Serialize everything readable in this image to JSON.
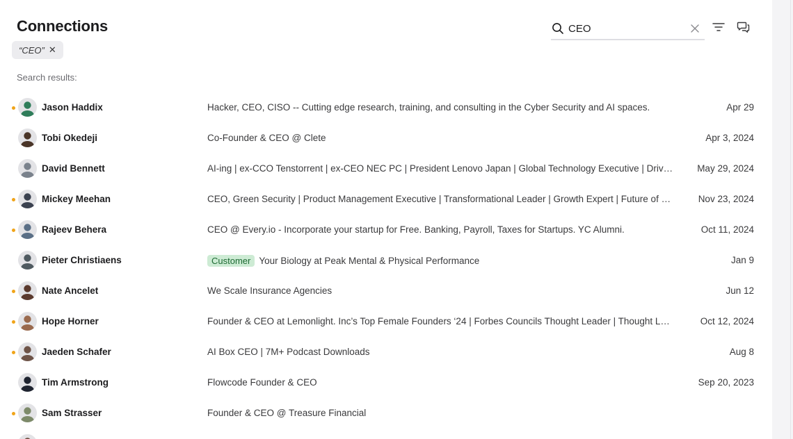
{
  "page": {
    "title": "Connections",
    "search_results_label": "Search results:"
  },
  "filter_chip": {
    "label": "“CEO”",
    "remove_glyph": "✕"
  },
  "search": {
    "value": "CEO"
  },
  "toolbar": {
    "filter_icon": "filter-icon",
    "message_icon": "message-icon"
  },
  "colors": {
    "unread_dot": "#f0a419",
    "badge_bg": "#cdebd4",
    "badge_text": "#1e6b34"
  },
  "connections": [
    {
      "name": "Jason Haddix",
      "headline": "Hacker, CEO, CISO -- Cutting edge research, training, and consulting in the Cyber Security and AI spaces.",
      "date": "Apr 29",
      "unread": true,
      "badge": "",
      "avatar_color": "#2f7d5a"
    },
    {
      "name": "Tobi Okedeji",
      "headline": "Co-Founder & CEO @ Clete",
      "date": "Apr 3, 2024",
      "unread": false,
      "badge": "",
      "avatar_color": "#4a3528"
    },
    {
      "name": "David Bennett",
      "headline": "AI-ing | ex-CCO Tenstorrent | ex-CEO NEC PC | President Lenovo Japan | Global Technology Executive | Driving growth and transformation",
      "date": "May 29, 2024",
      "unread": false,
      "badge": "",
      "avatar_color": "#7a828c"
    },
    {
      "name": "Mickey Meehan",
      "headline": "CEO, Green Security | Product Management Executive | Transformational Leader | Growth Expert | Future of Work",
      "date": "Nov 23, 2024",
      "unread": true,
      "badge": "",
      "avatar_color": "#3b4250"
    },
    {
      "name": "Rajeev Behera",
      "headline": "CEO @ Every.io - Incorporate your startup for Free. Banking, Payroll, Taxes for Startups. YC Alumni.",
      "date": "Oct 11, 2024",
      "unread": true,
      "badge": "",
      "avatar_color": "#5a6f86"
    },
    {
      "name": "Pieter Christiaens",
      "headline": "Your Biology at Peak Mental & Physical Performance",
      "date": "Jan 9",
      "unread": false,
      "badge": "Customer",
      "avatar_color": "#4f5a60"
    },
    {
      "name": "Nate Ancelet",
      "headline": "We Scale Insurance Agencies",
      "date": "Jun 12",
      "unread": true,
      "badge": "",
      "avatar_color": "#5b3a2e"
    },
    {
      "name": "Hope Horner",
      "headline": "Founder & CEO at Lemonlight. Inc’s Top Female Founders ‘24 | Forbes Councils Thought Leader | Thought Leadership",
      "date": "Oct 12, 2024",
      "unread": true,
      "badge": "",
      "avatar_color": "#9a6a4e"
    },
    {
      "name": "Jaeden Schafer",
      "headline": "AI Box CEO | 7M+ Podcast Downloads",
      "date": "Aug 8",
      "unread": true,
      "badge": "",
      "avatar_color": "#6e5448"
    },
    {
      "name": "Tim Armstrong",
      "headline": "Flowcode Founder & CEO",
      "date": "Sep 20, 2023",
      "unread": false,
      "badge": "",
      "avatar_color": "#1f2430"
    },
    {
      "name": "Sam Strasser",
      "headline": "Founder & CEO @ Treasure Financial",
      "date": "",
      "unread": true,
      "badge": "",
      "avatar_color": "#7d8a6a"
    },
    {
      "name": "",
      "headline": "",
      "date": "",
      "unread": false,
      "badge": "",
      "avatar_color": "#6a4a3c"
    }
  ]
}
